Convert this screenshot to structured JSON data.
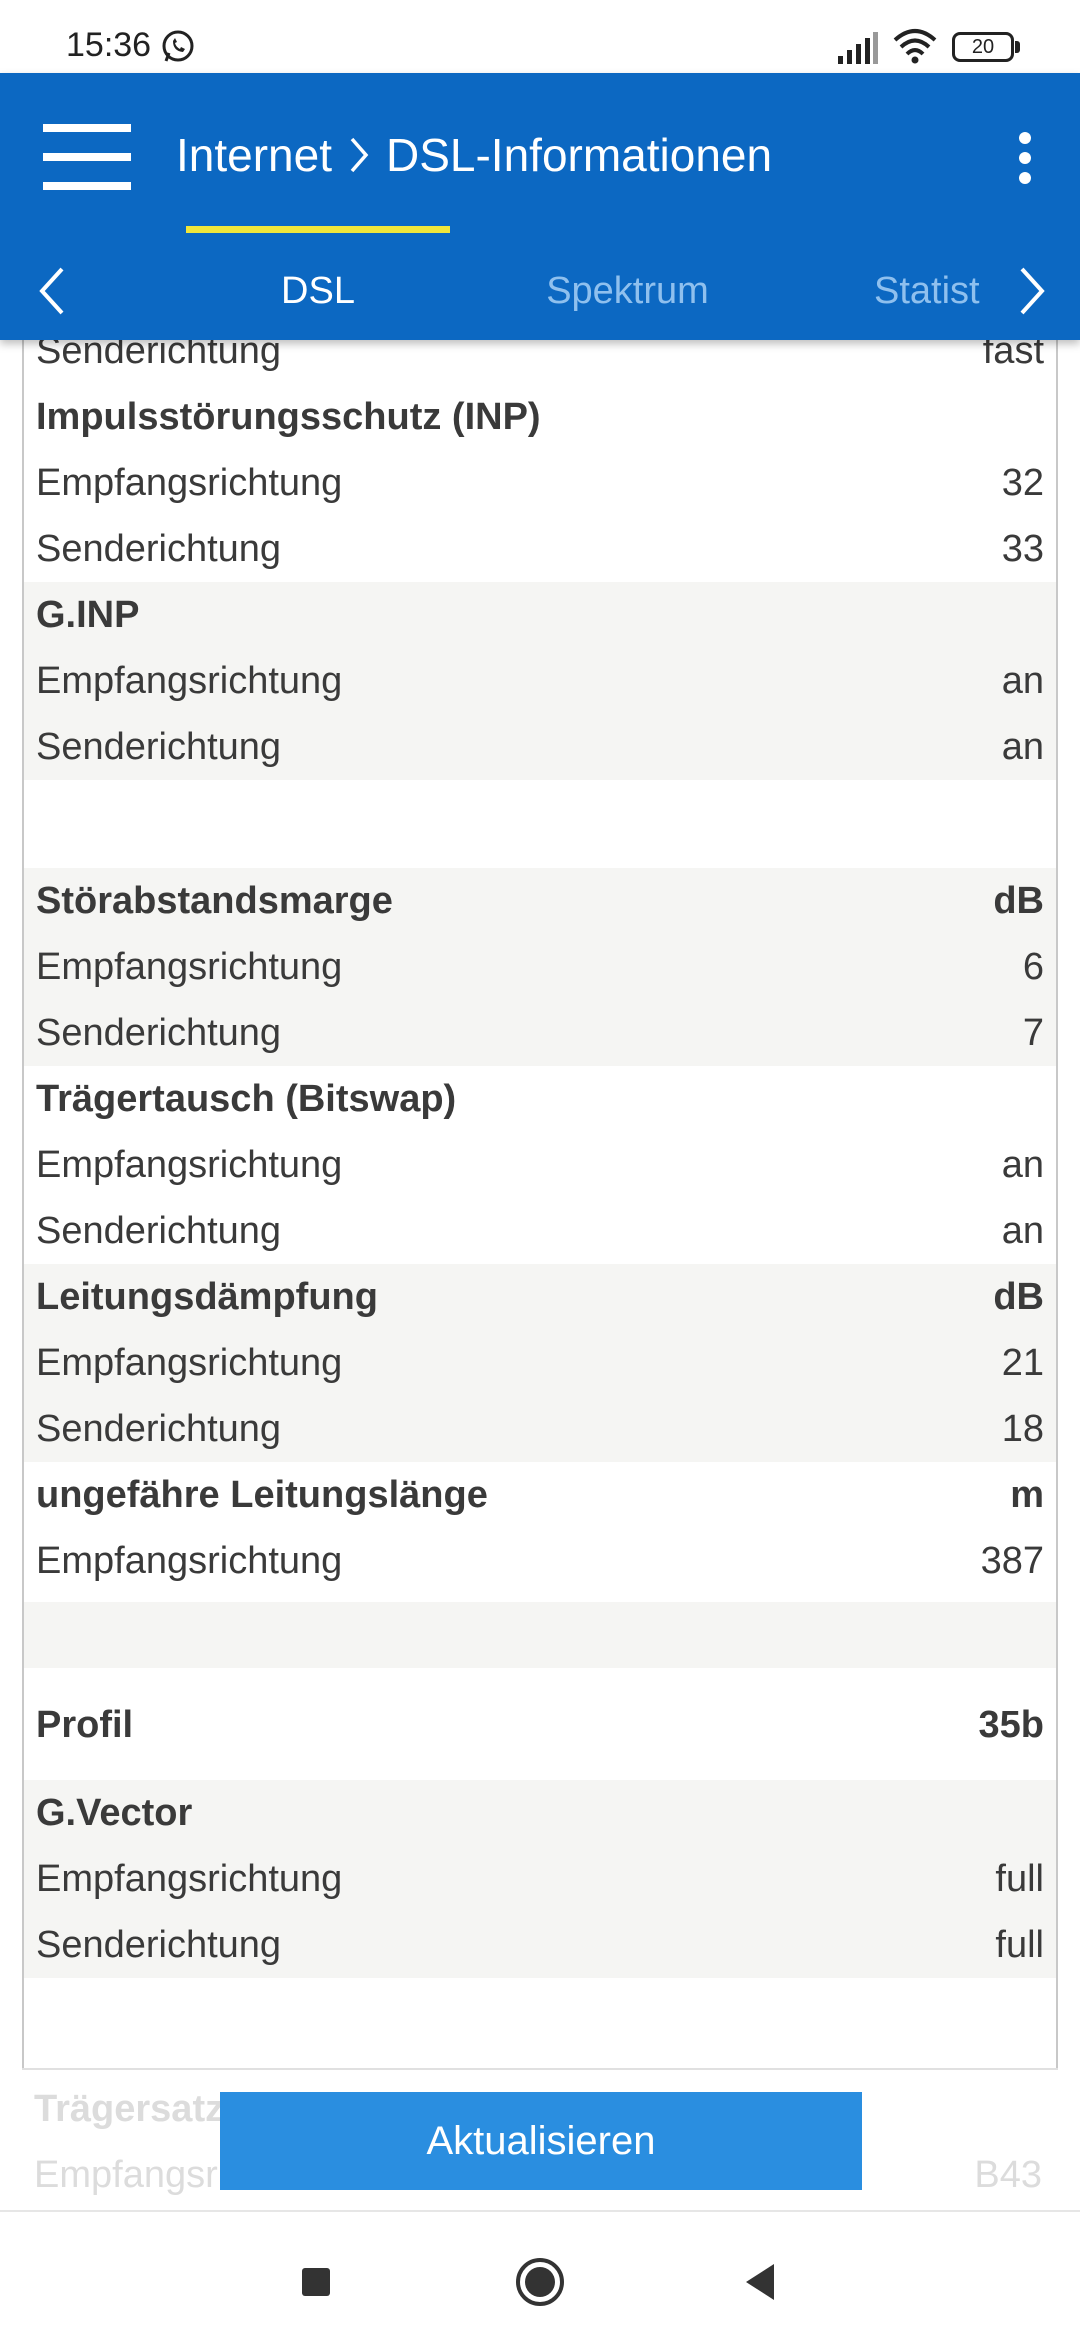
{
  "status_bar": {
    "time": "15:36",
    "battery": "20"
  },
  "app_bar": {
    "breadcrumb_parent": "Internet",
    "breadcrumb_current": "DSL-Informationen",
    "bg_color": "#0c68c2"
  },
  "tabs": [
    {
      "label": "DSL",
      "active": true
    },
    {
      "label": "Spektrum",
      "active": false
    },
    {
      "label": "Statistik",
      "active": false
    }
  ],
  "rows": {
    "r0": {
      "label": "Senderichtung",
      "value": "fast"
    },
    "r1": {
      "label": "Impulsstörungsschutz (INP)",
      "value": ""
    },
    "r2": {
      "label": "Empfangsrichtung",
      "value": "32"
    },
    "r3": {
      "label": "Senderichtung",
      "value": "33"
    },
    "r4": {
      "label": "G.INP",
      "value": ""
    },
    "r5": {
      "label": "Empfangsrichtung",
      "value": "an"
    },
    "r6": {
      "label": "Senderichtung",
      "value": "an"
    },
    "r7": {
      "label": "Störabstandsmarge",
      "value": "dB"
    },
    "r8": {
      "label": "Empfangsrichtung",
      "value": "6"
    },
    "r9": {
      "label": "Senderichtung",
      "value": "7"
    },
    "r10": {
      "label": "Trägertausch (Bitswap)",
      "value": ""
    },
    "r11": {
      "label": "Empfangsrichtung",
      "value": "an"
    },
    "r12": {
      "label": "Senderichtung",
      "value": "an"
    },
    "r13": {
      "label": "Leitungsdämpfung",
      "value": "dB"
    },
    "r14": {
      "label": "Empfangsrichtung",
      "value": "21"
    },
    "r15": {
      "label": "Senderichtung",
      "value": "18"
    },
    "r16": {
      "label": "ungefähre Leitungslänge",
      "value": "m"
    },
    "r17": {
      "label": "Empfangsrichtung",
      "value": "387"
    },
    "r18": {
      "label": "Profil",
      "value": "35b"
    },
    "r19": {
      "label": "G.Vector",
      "value": ""
    },
    "r20": {
      "label": "Empfangsrichtung",
      "value": "full"
    },
    "r21": {
      "label": "Senderichtung",
      "value": "full"
    },
    "r22": {
      "label": "Trägersatz",
      "value": ""
    },
    "r23": {
      "label": "Empfangsr",
      "value": "B43"
    }
  },
  "update_button": {
    "label": "Aktualisieren",
    "color": "#2a8ee0"
  },
  "icons": {
    "menu": "hamburger-menu-icon",
    "more": "kebab-menu-icon",
    "prev": "chevron-left-icon",
    "next": "chevron-right-icon"
  }
}
